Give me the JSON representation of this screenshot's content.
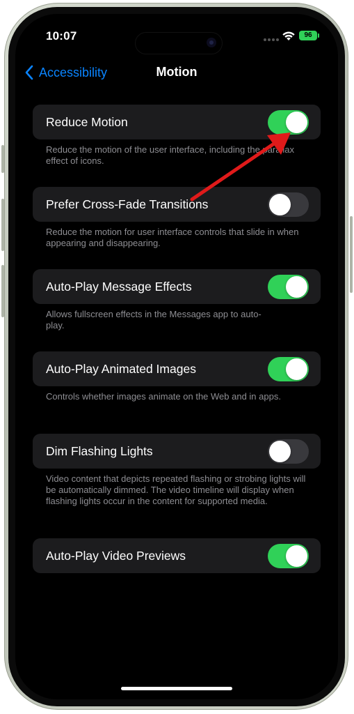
{
  "status_bar": {
    "time": "10:07",
    "battery": "96"
  },
  "nav": {
    "back_label": "Accessibility",
    "title": "Motion"
  },
  "settings": [
    {
      "label": "Reduce Motion",
      "on": true,
      "description": "Reduce the motion of the user interface, including the parallax effect of icons."
    },
    {
      "label": "Prefer Cross-Fade Transitions",
      "on": false,
      "description": "Reduce the motion for user interface controls that slide in when appearing and disappearing."
    },
    {
      "label": "Auto-Play Message Effects",
      "on": true,
      "description": "Allows fullscreen effects in the Messages app to auto-play."
    },
    {
      "label": "Auto-Play Animated Images",
      "on": true,
      "description": "Controls whether images animate on the Web and in apps."
    },
    {
      "label": "Dim Flashing Lights",
      "on": false,
      "description": "Video content that depicts repeated flashing or strobing lights will be automatically dimmed. The video timeline will display when flashing lights occur in the content for supported media."
    },
    {
      "label": "Auto-Play Video Previews",
      "on": true,
      "description": ""
    }
  ],
  "colors": {
    "accent": "#0a84ff",
    "toggle_on": "#30d158",
    "toggle_off": "#39393d",
    "annotation_arrow": "#e01a1a"
  },
  "icons": {
    "back": "chevron-left-icon",
    "wifi": "wifi-icon",
    "battery": "battery-icon",
    "annotation": "red-arrow-icon"
  }
}
